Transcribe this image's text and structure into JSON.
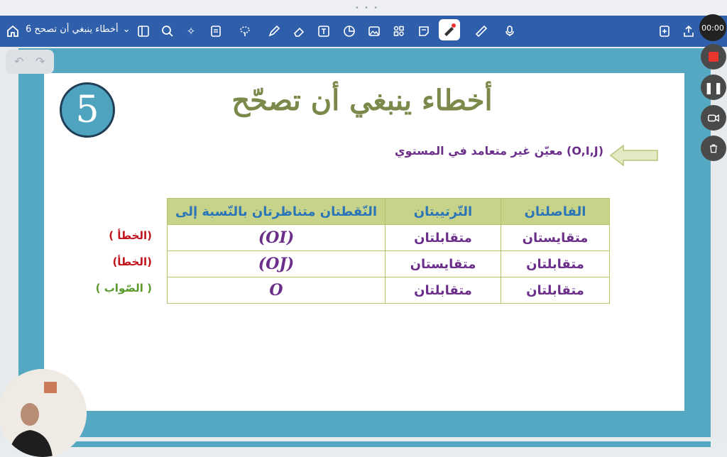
{
  "toolbar": {
    "doc_title": "أخطاء ينبغي أن تصحح 6",
    "icons": [
      "home-icon",
      "doc-title",
      "sidebar-icon",
      "search-icon",
      "sparkle-icon",
      "notes-icon",
      "lasso-icon",
      "pen-icon",
      "eraser-icon",
      "text-icon",
      "shape-icon",
      "image-icon",
      "elements-icon",
      "sticky-note-icon",
      "laser-pointer-icon",
      "ruler-icon",
      "microphone-icon",
      "add-page-icon",
      "share-icon",
      "more-icon"
    ]
  },
  "recorder": {
    "time": "00:00"
  },
  "slide": {
    "number": "5",
    "title": "أخطاء ينبغي أن تصحّح",
    "subtitle": "(O,I,J) معيّن غير متعامد في المستوي",
    "headers": [
      "الفاصلتان",
      "التّرتيبتان",
      "النّقطتان متناظرتان بالنّسبة إلى"
    ],
    "rows": [
      [
        "متقايستان",
        "متقابلتان",
        "(OI)"
      ],
      [
        "متقابلتان",
        "متقايستان",
        "(OJ)"
      ],
      [
        "متقابلتان",
        "متقابلتان",
        "O"
      ]
    ],
    "marks": [
      {
        "text": "(الخطأ )",
        "color": "#c0141c"
      },
      {
        "text": "(الخطأ)",
        "color": "#c0141c"
      },
      {
        "text": "( الصّواب )",
        "color": "#5a9a2a"
      }
    ]
  }
}
